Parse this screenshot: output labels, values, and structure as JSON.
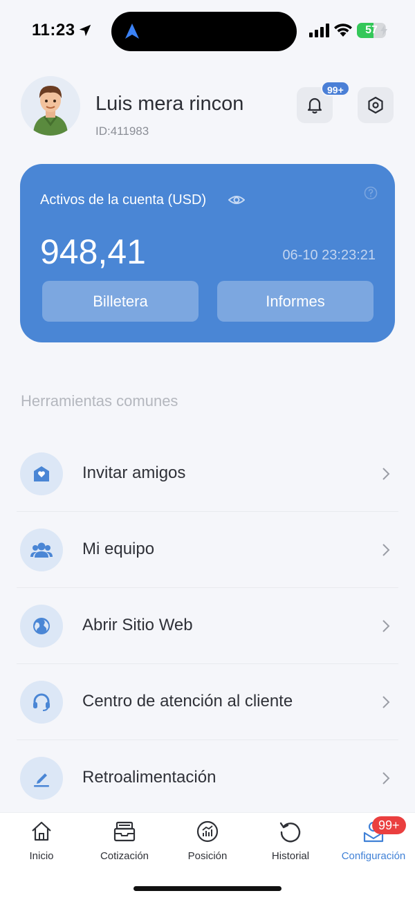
{
  "status_bar": {
    "time": "11:23",
    "battery": "57",
    "battery_level": 0.57
  },
  "profile": {
    "name": "Luis mera rincon",
    "id_label": "ID:411983",
    "notification_badge": "99+"
  },
  "account": {
    "label": "Activos de la cuenta (USD)",
    "balance": "948,41",
    "timestamp": "06-10 23:23:21",
    "wallet_label": "Billetera",
    "reports_label": "Informes"
  },
  "tools": {
    "section_title": "Herramientas comunes",
    "items": [
      {
        "label": "Invitar amigos",
        "icon": "invite-icon"
      },
      {
        "label": "Mi equipo",
        "icon": "team-icon"
      },
      {
        "label": "Abrir Sitio Web",
        "icon": "globe-icon"
      },
      {
        "label": "Centro de atención al cliente",
        "icon": "headset-icon"
      },
      {
        "label": "Retroalimentación",
        "icon": "pen-icon"
      }
    ]
  },
  "tab_bar": {
    "items": [
      {
        "label": "Inicio",
        "icon": "home-icon"
      },
      {
        "label": "Cotización",
        "icon": "quote-icon"
      },
      {
        "label": "Posición",
        "icon": "chart-icon"
      },
      {
        "label": "Historial",
        "icon": "history-icon"
      },
      {
        "label": "Configuración",
        "icon": "settings-person-icon"
      }
    ],
    "active_index": 4,
    "badge": "99+"
  },
  "colors": {
    "accent": "#4a86d5",
    "badge_red": "#ea3f3f",
    "background": "#f5f6fa"
  }
}
